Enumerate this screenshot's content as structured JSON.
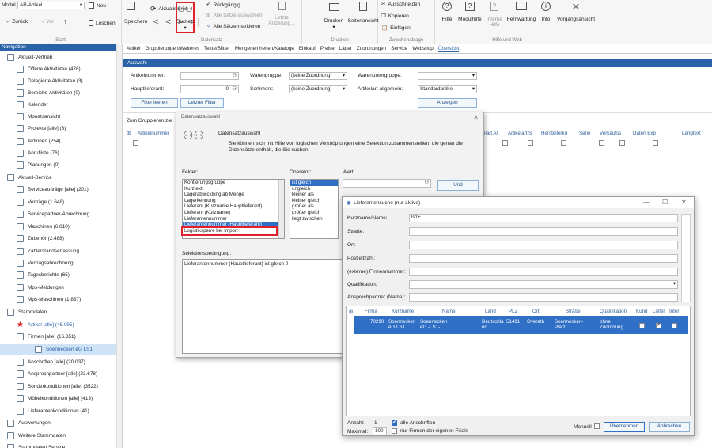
{
  "ribbon": {
    "modul_label": "Modul",
    "modul_value": "AR-Artikel",
    "neu": "Neu",
    "zuruck": "← Zurück",
    "vor": "→ Vor",
    "loschen": "Löschen",
    "start": "Start",
    "speichern": "Speichern",
    "aktualisieren": "Aktualisieren",
    "suchen": "Suchen",
    "ruckgangig": "Rückgängig",
    "alle_auswahlen": "Alle Sätze auswählen",
    "alle_markieren": "Alle Sätze markieren",
    "letzte_anderung": "Letzte Änderung...",
    "datensatz": "Datensatz",
    "drucken": "Drucken",
    "seitenansicht": "Seitenansicht",
    "drucken_grp": "Drucken",
    "ausschneiden": "Ausschneiden",
    "kopieren": "Kopieren",
    "einfugen": "Einfügen",
    "zwischenablage": "Zwischenablage",
    "hilfe": "Hilfe",
    "modulhilfe": "Modulhilfe",
    "interne_hilfe": "Interne Hilfe",
    "fernwartung": "Fernwartung",
    "info": "Info",
    "vorgangsansicht": "Vorgangsansicht",
    "hilfe_web": "Hilfe und Web"
  },
  "nav": {
    "title": "Navigation",
    "items": [
      "Aktuell-Vertrieb",
      "Offene Aktivitäten (476)",
      "Delegierte Aktivitäten (3)",
      "Bereichs-Aktivitäten (0)",
      "Kalender",
      "Monatsansicht",
      "Projekte [alle] (3)",
      "Aktionen (254)",
      "Anrufliste (76)",
      "Planungen (0)",
      "Aktuell-Service",
      "Serviceaufträge [alle] (201)",
      "Verträge (1.648)",
      "Servicepartner-Abrechnung",
      "Maschinen (6.810)",
      "Zubehör (2.488)",
      "Zählerstandserfassung",
      "Vertragsabrechnung",
      "Tagesberichte (65)",
      "Mps-Meldungen",
      "Mps-Maschinen (1.837)",
      "Stammdaten",
      "Artikel [alle] (46.095)",
      "Firmen [alle] (16.351)",
      "Soennecken eG LS1",
      "Anschriften [alle] (20.037)",
      "Ansprechpartner [alle] (23.678)",
      "Sonderkonditionen [alle] (3522)",
      "Möbelkonditionen [alle] (413)",
      "Lieferantenkonditionen (41)",
      "Auswertungen",
      "Weitere Stammdaten",
      "Stammdaten Service"
    ]
  },
  "menubar": [
    "Artikel",
    "Gruppierungen/Weiteres",
    "Texte/Bilder",
    "Mengeneinheiten/Kataloge",
    "Einkauf",
    "Preise",
    "Läger",
    "Zuordnungen",
    "Service",
    "Webshop",
    "Übersicht"
  ],
  "auswahl": {
    "title": "Auswahl",
    "artikelnummer": "Artikelnummer:",
    "warengruppe": "Warengruppe:",
    "warengruppe_val": "(keine Zuordnung)",
    "warenuntergruppe": "Warenuntergruppe:",
    "hauptlieferant": "Hauptlieferant:",
    "hauptlieferant_val": "0",
    "sortiment": "Sortiment:",
    "sortiment_val": "(keine Zuordnung)",
    "artikelart": "Artikelart allgemein:",
    "artikelart_val": "Standardartikel",
    "filter_leeren": "Filter leeren",
    "letzter_filter": "Letzter Filter",
    "anzeigen": "Anzeigen"
  },
  "grid": {
    "group_hint": "Zum Gruppieren zie",
    "col_artikelnummer": "Artikelnummer",
    "right_cols": [
      "elart Al",
      "Artikelart S",
      "Herstellerkü",
      "Serie",
      "Verkaufss",
      "Daten Exp",
      "Langtext"
    ]
  },
  "dsa": {
    "title": "Datensatzauswahl",
    "heading": "Datensatzauswahl",
    "desc": "Sie können sich mit Hilfe von logischen Verknüpfungen eine Selektion zusammenstellen, die genau die Datensätze enthält, die Sie suchen.",
    "felder": "Felder:",
    "operator": "Operator:",
    "wert": "Wert:",
    "fields": [
      "Kontierungsgruppe",
      "Kurztext",
      "Lagerabwicklung ab Menge",
      "Lagerkennung",
      "Lieferant (Kurzname Hauptlieferant)",
      "Lieferant (Kurzname)",
      "Lieferantennummer",
      "Lieferantennummer (Hauptlieferant)",
      "Logistiksperre bei Import"
    ],
    "operators": [
      "ist gleich",
      "ungleich",
      "kleiner als",
      "kleiner gleich",
      "größer als",
      "größer gleich",
      "liegt zwischen"
    ],
    "und": "Und",
    "selektion_label": "Selektionsbedingung:",
    "selektion_text": "Lieferantennummer (Hauptlieferant) ist gleich 0"
  },
  "ls": {
    "title": "Lieferantensuche (nur aktive)",
    "kurzname": "Kurzname/Name:",
    "kurzname_val": "ls1+",
    "strasse": "Straße:",
    "ort": "Ort:",
    "plz": "Postleitzahl:",
    "firmennummer": "(externe) Firmennummer:",
    "qualifikation": "Qualifikation:",
    "ansprechpartner": "Ansprechpartner (Name):",
    "cols": [
      "Firma",
      "Kurzname",
      "Name",
      "Land",
      "PLZ",
      "Ort",
      "Straße",
      "Qualifikation",
      "Kund",
      "Liefer",
      "Inter"
    ],
    "row": {
      "firma": "70290",
      "kurzname": "Soennecken eG LS1",
      "name": "Soennecken eG -LS1-",
      "land": "Deutschland",
      "plz": "51491",
      "ort": "Overath",
      "strasse": "Soennecken-Platz",
      "qualifikation": "ohne Zuordnung"
    },
    "anzahl_label": "Anzahl:",
    "anzahl": "1",
    "maximal_label": "Maximal:",
    "maximal": "100",
    "alle_anschriften": "alle Anschriften",
    "nur_firmen": "nur Firmen der eigenen Filiale",
    "manuell": "Manuell",
    "ubernehmen": "Übernehmen",
    "abbrechen": "Abbrechen"
  },
  "colors": {
    "accent": "#2a62a8",
    "highlight": "#e0202a",
    "selection": "#2f6fc5"
  }
}
